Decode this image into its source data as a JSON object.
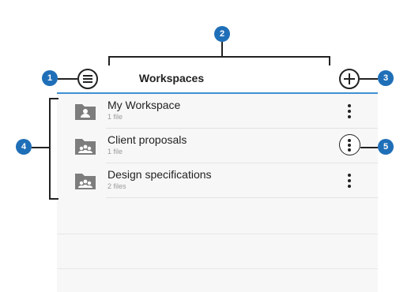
{
  "header": {
    "title": "Workspaces",
    "menu_icon": "hamburger-menu-icon",
    "add_icon": "plus-icon"
  },
  "workspaces": [
    {
      "name": "My Workspace",
      "count": "1 file",
      "icon": "folder-person-icon"
    },
    {
      "name": "Client proposals",
      "count": "1 file",
      "icon": "folder-group-icon"
    },
    {
      "name": "Design specifications",
      "count": "2 files",
      "icon": "folder-group-icon"
    }
  ],
  "callouts": [
    "1",
    "2",
    "3",
    "4",
    "5"
  ],
  "colors": {
    "accent": "#3f8fd2",
    "callout": "#1f6fb8",
    "folder": "#7d7d7d",
    "text": "#222222",
    "subtext": "#9a9a9a"
  }
}
